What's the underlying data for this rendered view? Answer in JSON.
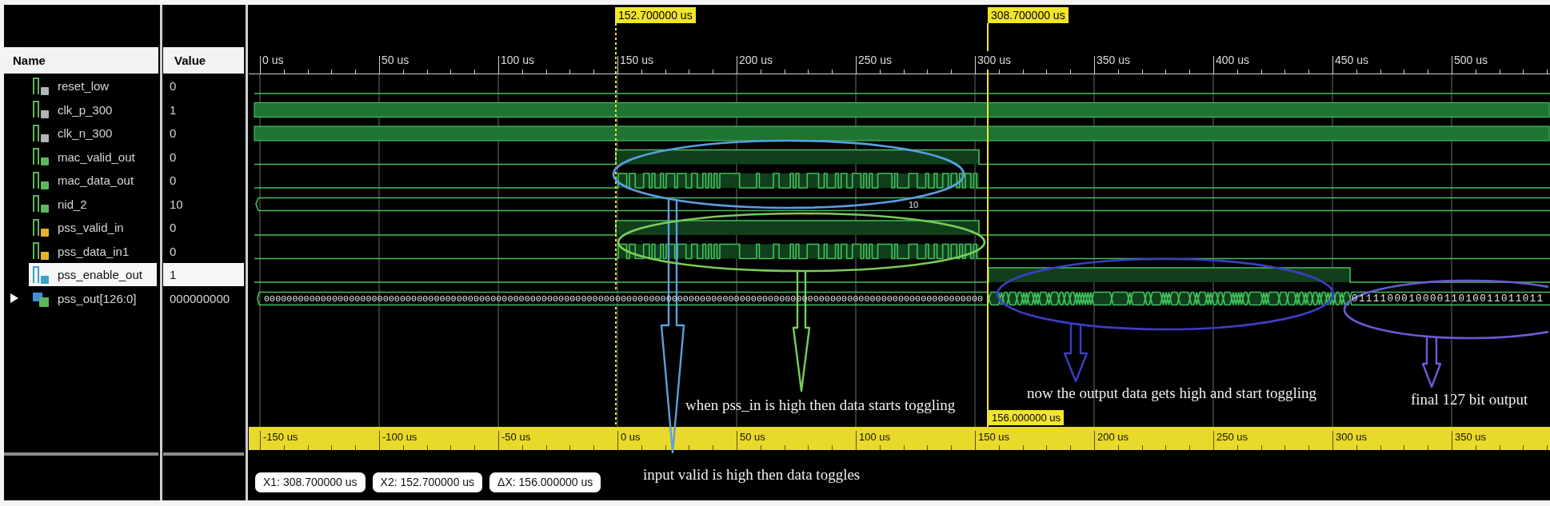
{
  "columns": {
    "name": "Name",
    "value": "Value"
  },
  "signals": [
    {
      "name": "reset_low",
      "value": "0",
      "kind": "constant",
      "color": "#b4b4b4",
      "selected": false
    },
    {
      "name": "clk_p_300",
      "value": "1",
      "kind": "clock",
      "color": "#b4b4b4",
      "selected": false
    },
    {
      "name": "clk_n_300",
      "value": "0",
      "kind": "clock",
      "color": "#b4b4b4",
      "selected": false
    },
    {
      "name": "mac_valid_out",
      "value": "0",
      "kind": "pulse",
      "color": "#5cb85c",
      "selected": false
    },
    {
      "name": "mac_data_out",
      "value": "0",
      "kind": "toggle",
      "color": "#5cb85c",
      "selected": false
    },
    {
      "name": "nid_2",
      "value": "10",
      "kind": "word",
      "color": "#5cb85c",
      "selected": false,
      "wave_labels": [
        "10"
      ]
    },
    {
      "name": "pss_valid_in",
      "value": "0",
      "kind": "pulse",
      "color": "#e8b030",
      "selected": false
    },
    {
      "name": "pss_data_in1",
      "value": "0",
      "kind": "toggle",
      "color": "#e8b030",
      "selected": false
    },
    {
      "name": "pss_enable_out",
      "value": "1",
      "kind": "step",
      "color": "#3aa0c8",
      "selected": true
    },
    {
      "name": "pss_out[126:0]",
      "value": "000000000",
      "kind": "vector",
      "color": "#5cb85c",
      "selected": false,
      "expanded": false,
      "wave_labels": [
        "0000000000000000000000000000000000000000000000000000000000000000000000000000000000000000000000000000000000000000000000000000000",
        "011110001000011010011011011"
      ]
    }
  ],
  "time_ruler": [
    "0 us",
    "50 us",
    "100 us",
    "150 us",
    "200 us",
    "250 us",
    "300 us",
    "350 us",
    "400 us",
    "450 us",
    "500 us"
  ],
  "cursors": [
    {
      "label": "152.700000 us",
      "kind": "dashed"
    },
    {
      "label": "308.700000 us",
      "kind": "solid"
    }
  ],
  "cursor_delta": "156.000000 us",
  "relative_ruler": [
    "-150 us",
    "-100 us",
    "-50 us",
    "0 us",
    "50 us",
    "100 us",
    "150 us",
    "200 us",
    "250 us",
    "300 us",
    "350 us"
  ],
  "readouts": [
    "X1: 308.700000 us",
    "X2: 152.700000 us",
    "ΔX: 156.000000 us"
  ],
  "annotations": [
    {
      "text": "input valid is high then data toggles",
      "color": "#5a9fe0"
    },
    {
      "text": "when pss_in is high then data starts toggling",
      "color": "#7acb58"
    },
    {
      "text": "now the output data gets high and start toggling",
      "color": "#3d3dc4"
    },
    {
      "text": "final 127 bit output",
      "color": "#6b5bd2"
    }
  ]
}
